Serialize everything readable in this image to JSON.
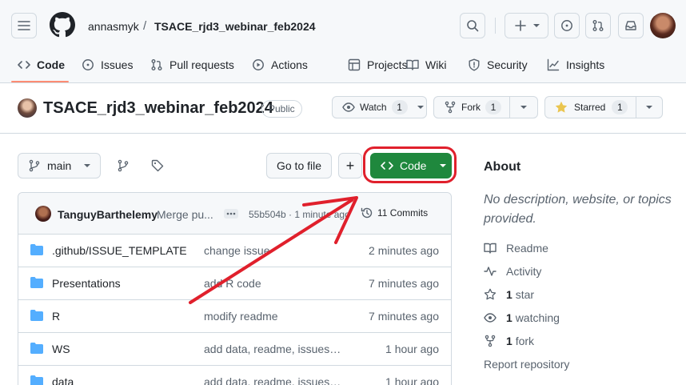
{
  "header": {
    "owner": "annasmyk",
    "separator": "/",
    "repo": "TSACE_rjd3_webinar_feb2024"
  },
  "tabs": [
    {
      "label": "Code"
    },
    {
      "label": "Issues"
    },
    {
      "label": "Pull requests"
    },
    {
      "label": "Actions"
    },
    {
      "label": "Projects"
    },
    {
      "label": "Wiki"
    },
    {
      "label": "Security"
    },
    {
      "label": "Insights"
    }
  ],
  "repo_title": {
    "name": "TSACE_rjd3_webinar_feb2024",
    "visibility": "Public"
  },
  "repo_actions": {
    "watch_label": "Watch",
    "watch_count": "1",
    "fork_label": "Fork",
    "fork_count": "1",
    "star_label": "Starred",
    "star_count": "1"
  },
  "toolbar": {
    "branch": "main",
    "go_to_file": "Go to file",
    "add": "+",
    "code": "Code"
  },
  "commit": {
    "author": "TanguyBarthelemy",
    "message": "Merge pu...",
    "hash_time": "55b504b · 1 minute ago",
    "commits": "11 Commits"
  },
  "files": [
    {
      "name": ".github/ISSUE_TEMPLATE",
      "message": "change issue",
      "time": "2 minutes ago"
    },
    {
      "name": "Presentations",
      "message": "add R code",
      "time": "7 minutes ago"
    },
    {
      "name": "R",
      "message": "modify readme",
      "time": "7 minutes ago"
    },
    {
      "name": "WS",
      "message": "add data, readme, issues a...",
      "time": "1 hour ago"
    },
    {
      "name": "data",
      "message": "add data, readme, issues a...",
      "time": "1 hour ago"
    }
  ],
  "about": {
    "title": "About",
    "description": "No description, website, or topics provided.",
    "readme": "Readme",
    "activity": "Activity",
    "stars_num": "1",
    "stars_label": "star",
    "watching_num": "1",
    "watching_label": "watching",
    "forks_num": "1",
    "forks_label": "fork",
    "report": "Report repository"
  },
  "colors": {
    "accent_green": "#1f883d",
    "annotation_red": "#e0202c",
    "tab_underline": "#fd8c73",
    "folder_blue": "#54aeff"
  }
}
